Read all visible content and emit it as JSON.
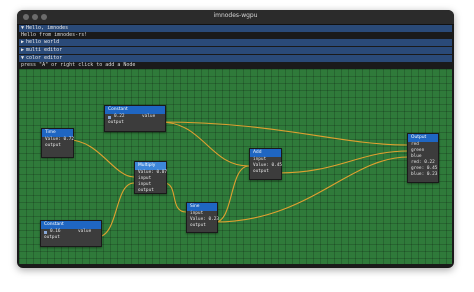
{
  "window": {
    "title": "imnodes-wgpu"
  },
  "panels": [
    {
      "label": "Hello, imnodes",
      "arrow": "▼"
    },
    {
      "label": "hello world",
      "arrow": "▶"
    },
    {
      "label": "multi editor",
      "arrow": "▶"
    },
    {
      "label": "color editor",
      "arrow": "▼"
    }
  ],
  "hello_text": "Hello from imnodes-rs!",
  "hint": "press \"A\" or right click to add a Node",
  "nodes": {
    "time": {
      "title": "Time",
      "value_row": "Value: 0.72",
      "output": "output"
    },
    "constant_top": {
      "title": "Constant",
      "value": "0.22",
      "value_label": "value",
      "output": "output"
    },
    "multiply": {
      "title": "Multiply",
      "value_row": "Value: 0.07",
      "input1": "input",
      "input2": "input",
      "output": "output"
    },
    "add": {
      "title": "Add",
      "input1": "input",
      "value_row": "Value: 0.45",
      "output": "output"
    },
    "sine": {
      "title": "Sine",
      "input1": "input",
      "value_row": "Value: 0.23",
      "output": "output"
    },
    "constant_bottom": {
      "title": "Constant",
      "value": "0.16",
      "value_label": "value",
      "output": "output"
    },
    "output": {
      "title": "Output",
      "red": "red",
      "green": "green",
      "blue": "blue",
      "red_val": "red: 0.22",
      "green_val": "gree: 0.45",
      "blue_val": "blue: 0.23"
    }
  },
  "colors": {
    "canvas": "#2f7a3a",
    "node_title": "#1f66c2",
    "link": "#e0a030"
  }
}
